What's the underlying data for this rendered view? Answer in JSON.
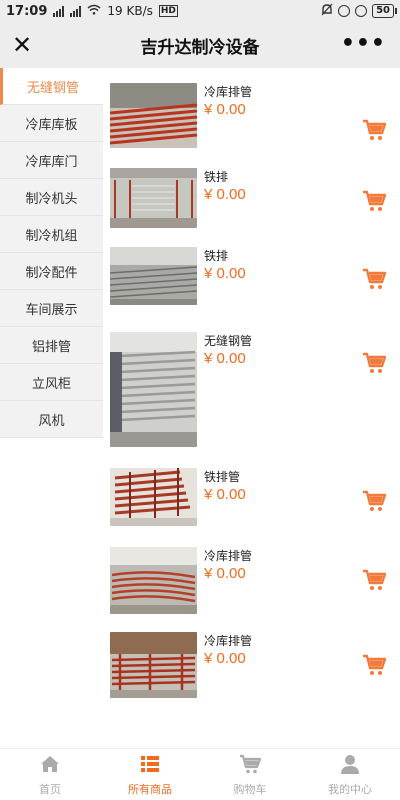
{
  "status": {
    "time": "17:09",
    "network": "19 KB/s",
    "battery": "50"
  },
  "header": {
    "title": "吉升达制冷设备",
    "close_icon": "close-icon",
    "more_icon": "more-icon"
  },
  "colors": {
    "accent": "#f08a4b",
    "price": "#f26b1d",
    "cart": "#f27a3a",
    "bar_bg": "#ededed"
  },
  "sidebar": {
    "items": [
      {
        "label": "无缝钢管",
        "active": true
      },
      {
        "label": "冷库库板"
      },
      {
        "label": "冷库库门"
      },
      {
        "label": "制冷机头"
      },
      {
        "label": "制冷机组"
      },
      {
        "label": "制冷配件"
      },
      {
        "label": "车间展示"
      },
      {
        "label": "铝排管"
      },
      {
        "label": "立风柜"
      },
      {
        "label": "风机"
      }
    ]
  },
  "products": [
    {
      "name": "冷库排管",
      "price": "¥ 0.00",
      "image": "red-steel-pipes-photo"
    },
    {
      "name": "铁排",
      "price": "¥ 0.00",
      "image": "cold-room-coil-photo"
    },
    {
      "name": "铁排",
      "price": "¥ 0.00",
      "image": "grey-coil-on-ground-photo"
    },
    {
      "name": "无缝钢管",
      "price": "¥ 0.00",
      "image": "steel-coil-stack-photo"
    },
    {
      "name": "铁排管",
      "price": "¥ 0.00",
      "image": "red-coil-stack-photo"
    },
    {
      "name": "冷库排管",
      "price": "¥ 0.00",
      "image": "red-pipes-on-ground-photo"
    },
    {
      "name": "冷库排管",
      "price": "¥ 0.00",
      "image": "red-pipes-yard-photo"
    }
  ],
  "tabbar": {
    "items": [
      {
        "label": "首页",
        "icon": "home-icon"
      },
      {
        "label": "所有商品",
        "icon": "list-icon",
        "active": true
      },
      {
        "label": "购物车",
        "icon": "cart-icon"
      },
      {
        "label": "我的中心",
        "icon": "user-icon"
      }
    ]
  }
}
